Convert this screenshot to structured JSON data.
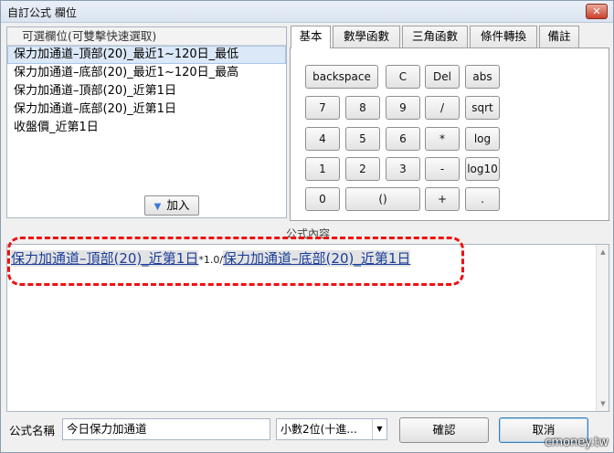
{
  "window": {
    "title": "自訂公式 欄位"
  },
  "fields": {
    "header": "可選欄位(可雙擊快速選取)",
    "items": [
      "保力加通道–頂部(20)_最近1~120日_最低",
      "保力加通道–底部(20)_最近1~120日_最高",
      "保力加通道–頂部(20)_近第1日",
      "保力加通道–底部(20)_近第1日",
      "收盤價_近第1日"
    ],
    "add_label": "加入"
  },
  "tabs": [
    "基本",
    "數學函數",
    "三角函數",
    "條件轉換",
    "備註"
  ],
  "calc": {
    "buttons": [
      "backspace",
      "C",
      "Del",
      "abs",
      "7",
      "8",
      "9",
      "/",
      "sqrt",
      "4",
      "5",
      "6",
      "*",
      "log",
      "1",
      "2",
      "3",
      "-",
      "log10",
      "0",
      "()",
      "+",
      "."
    ]
  },
  "formula": {
    "header": "公式內容",
    "ref1": "保力加通道–頂部(20)_近第1日",
    "op": "*1.0/",
    "ref2": "保力加通道–底部(20)_近第1日"
  },
  "bottom": {
    "name_label": "公式名稱",
    "name_value": "今日保力加通道",
    "decimal": "小數2位(十進...",
    "ok": "確認",
    "cancel": "取消"
  },
  "watermark": "cmoney.tw",
  "colors": {
    "highlight": "#e11111",
    "link": "#1c3f9a"
  }
}
